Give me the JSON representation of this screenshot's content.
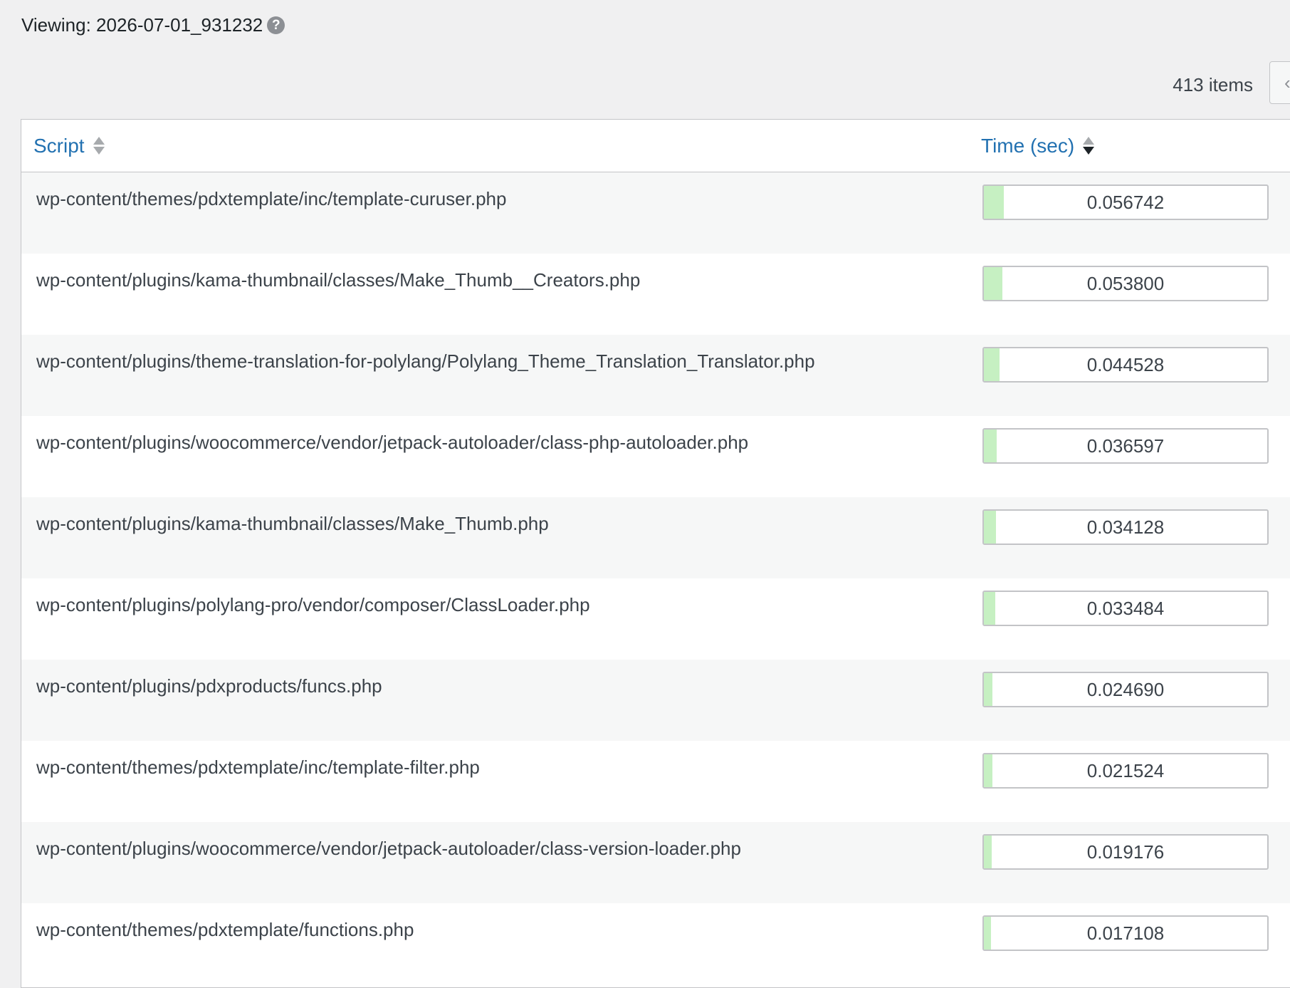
{
  "header": {
    "viewing_label": "Viewing: 2026-07-01_931232",
    "help_icon": "question-circle-icon"
  },
  "pagination": {
    "items_count": "413 items",
    "prev_icon": "chevron-left-icon"
  },
  "table": {
    "columns": {
      "script": "Script",
      "time": "Time (sec)"
    },
    "sort": {
      "column": "time",
      "direction": "desc"
    },
    "fill_color": "#c6f0c2",
    "rows": [
      {
        "script": "wp-content/themes/pdxtemplate/inc/template-curuser.php",
        "time": "0.056742",
        "fill_fraction": 0.07
      },
      {
        "script": "wp-content/plugins/kama-thumbnail/classes/Make_Thumb__Creators.php",
        "time": "0.053800",
        "fill_fraction": 0.065
      },
      {
        "script": "wp-content/plugins/theme-translation-for-polylang/Polylang_Theme_Translation_Translator.php",
        "time": "0.044528",
        "fill_fraction": 0.055
      },
      {
        "script": "wp-content/plugins/woocommerce/vendor/jetpack-autoloader/class-php-autoloader.php",
        "time": "0.036597",
        "fill_fraction": 0.045
      },
      {
        "script": "wp-content/plugins/kama-thumbnail/classes/Make_Thumb.php",
        "time": "0.034128",
        "fill_fraction": 0.042
      },
      {
        "script": "wp-content/plugins/polylang-pro/vendor/composer/ClassLoader.php",
        "time": "0.033484",
        "fill_fraction": 0.041
      },
      {
        "script": "wp-content/plugins/pdxproducts/funcs.php",
        "time": "0.024690",
        "fill_fraction": 0.031
      },
      {
        "script": "wp-content/themes/pdxtemplate/inc/template-filter.php",
        "time": "0.021524",
        "fill_fraction": 0.03
      },
      {
        "script": "wp-content/plugins/woocommerce/vendor/jetpack-autoloader/class-version-loader.php",
        "time": "0.019176",
        "fill_fraction": 0.028
      },
      {
        "script": "wp-content/themes/pdxtemplate/functions.php",
        "time": "0.017108",
        "fill_fraction": 0.024
      }
    ]
  }
}
